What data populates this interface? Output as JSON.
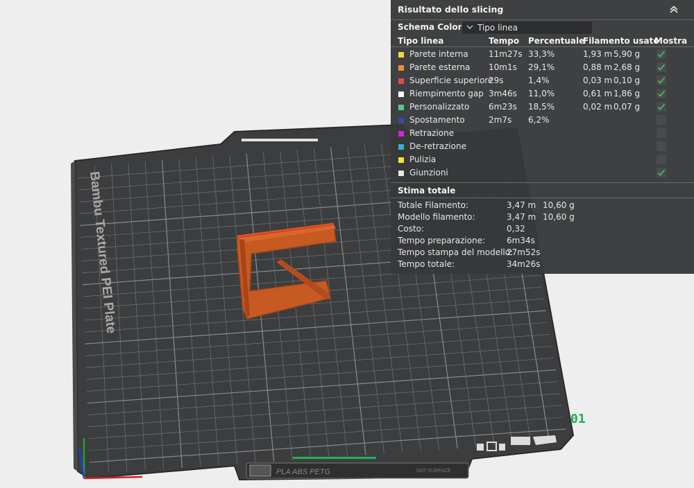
{
  "viewport": {
    "plate_label": "Bambu Textured PEI Plate",
    "plate_number": "01",
    "filament_tag": "PLA ABS PETG",
    "not_surface": "NOT SURFACE"
  },
  "panel": {
    "title": "Risultato dello slicing",
    "color_scheme_label": "Schema Colore",
    "color_scheme_value": "Tipo linea",
    "columns": {
      "type": "Tipo linea",
      "time": "Tempo",
      "percent": "Percentuale",
      "filament": "Filamento usato",
      "show": "Mostra"
    },
    "rows": [
      {
        "label": "Parete interna",
        "color": "#f2d53c",
        "time": "11m27s",
        "percent": "33,3%",
        "length": "1,93 m",
        "weight": "5,90 g",
        "show": true
      },
      {
        "label": "Parete esterna",
        "color": "#f28a3c",
        "time": "10m1s",
        "percent": "29,1%",
        "length": "0,88 m",
        "weight": "2,68 g",
        "show": true
      },
      {
        "label": "Superficie superiore",
        "color": "#e84a4a",
        "time": "29s",
        "percent": "1,4%",
        "length": "0,03 m",
        "weight": "0,10 g",
        "show": true
      },
      {
        "label": "Riempimento gap",
        "color": "#ffffff",
        "time": "3m46s",
        "percent": "11,0%",
        "length": "0,61 m",
        "weight": "1,86 g",
        "show": true
      },
      {
        "label": "Personalizzato",
        "color": "#5cc88a",
        "time": "6m23s",
        "percent": "18,5%",
        "length": "0,02 m",
        "weight": "0,07 g",
        "show": true
      },
      {
        "label": "Spostamento",
        "color": "#3a4aa8",
        "time": "2m7s",
        "percent": "6,2%",
        "length": "",
        "weight": "",
        "show": false
      },
      {
        "label": "Retrazione",
        "color": "#c828d8",
        "time": "",
        "percent": "",
        "length": "",
        "weight": "",
        "show": false
      },
      {
        "label": "De-retrazione",
        "color": "#3ab0d0",
        "time": "",
        "percent": "",
        "length": "",
        "weight": "",
        "show": false
      },
      {
        "label": "Pulizia",
        "color": "#f5e62a",
        "time": "",
        "percent": "",
        "length": "",
        "weight": "",
        "show": false
      },
      {
        "label": "Giunzioni",
        "color": "#e8e8e8",
        "time": "",
        "percent": "",
        "length": "",
        "weight": "",
        "show": true
      }
    ],
    "estimate_title": "Stima totale",
    "estimates": [
      {
        "label": "Totale Filamento:",
        "v1": "3,47 m",
        "v2": "10,60 g"
      },
      {
        "label": "Modello filamento:",
        "v1": "3,47 m",
        "v2": "10,60 g"
      },
      {
        "label": "Costo:",
        "v1": "0,32",
        "v2": ""
      },
      {
        "label": "Tempo preparazione:",
        "v1": "6m34s",
        "v2": ""
      },
      {
        "label": "Tempo stampa del modello:",
        "v1": "27m52s",
        "v2": ""
      },
      {
        "label": "Tempo totale:",
        "v1": "34m26s",
        "v2": ""
      }
    ]
  },
  "colors": {
    "check": "#3fbf5f",
    "accent": "#00ae42",
    "model": "#c75a22"
  }
}
